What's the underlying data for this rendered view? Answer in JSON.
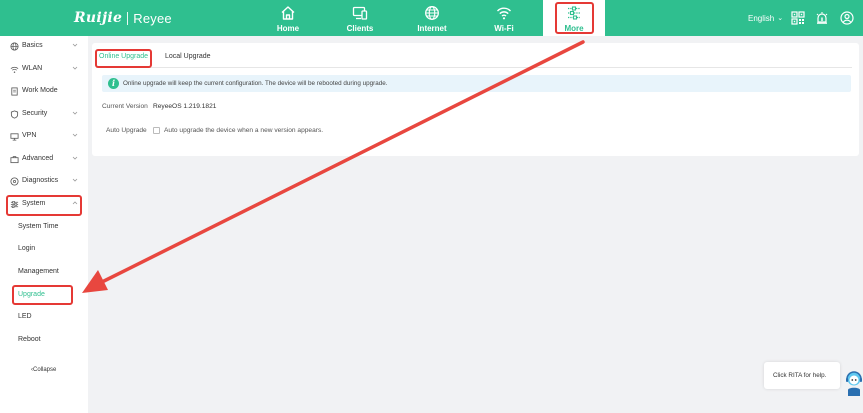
{
  "header": {
    "logo_primary": "Ruijie",
    "logo_secondary": "Reyee",
    "nav": [
      {
        "label": "Home",
        "icon": "home-icon"
      },
      {
        "label": "Clients",
        "icon": "monitor-icon"
      },
      {
        "label": "Internet",
        "icon": "globe-icon"
      },
      {
        "label": "Wi-Fi",
        "icon": "wifi-icon"
      },
      {
        "label": "More",
        "icon": "sliders-icon"
      }
    ],
    "language": "English",
    "icons": [
      "qr-code-icon",
      "alert-icon",
      "user-icon"
    ]
  },
  "sidebar": {
    "items": [
      {
        "label": "Basics",
        "icon": "globe-icon"
      },
      {
        "label": "WLAN",
        "icon": "wifi-icon"
      },
      {
        "label": "Work Mode",
        "icon": "document-icon"
      },
      {
        "label": "Security",
        "icon": "shield-icon"
      },
      {
        "label": "VPN",
        "icon": "vpn-icon"
      },
      {
        "label": "Advanced",
        "icon": "briefcase-icon"
      },
      {
        "label": "Diagnostics",
        "icon": "diagnostics-icon"
      },
      {
        "label": "System",
        "icon": "sliders-icon"
      }
    ],
    "system_sub": [
      {
        "label": "System Time"
      },
      {
        "label": "Login"
      },
      {
        "label": "Management"
      },
      {
        "label": "Upgrade"
      },
      {
        "label": "LED"
      },
      {
        "label": "Reboot"
      }
    ],
    "collapse_label": "Collapse"
  },
  "main": {
    "tabs": [
      {
        "label": "Online Upgrade"
      },
      {
        "label": "Local Upgrade"
      }
    ],
    "notice": "Online upgrade will keep the current configuration. The device will be rebooted during upgrade.",
    "current_version_label": "Current Version",
    "current_version_value": "ReyeeOS 1.219.1821",
    "auto_upgrade_label": "Auto Upgrade",
    "auto_upgrade_desc": "Auto upgrade the device when a new version appears."
  },
  "rita": {
    "text": "Click RITA for help."
  },
  "colors": {
    "accent": "#2fbf8f",
    "highlight": "#e53935"
  }
}
